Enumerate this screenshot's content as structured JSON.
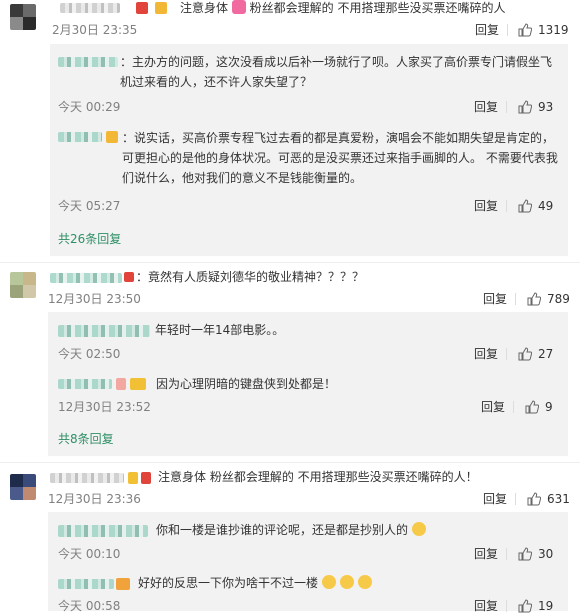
{
  "c0": {
    "text": "注意身体",
    "text2": "粉丝都会理解的  不用搭理那些没买票还嘴碎的人",
    "time": "2月30日 23:35",
    "reply": "回复",
    "likes": "1319"
  },
  "s1": {
    "text": "：主办方的问题，这次没看成以后补一场就行了呗。人家买了高价票专门请假坐飞机过来看的人，还不许人家失望了？",
    "time": "今天 00:29",
    "reply": "回复",
    "likes": "93"
  },
  "s2": {
    "text": "：说实话，买高价票专程飞过去看的都是真爱粉，演唱会不能如期失望是肯定的，可更担心的是他的身体状况。可恶的是没买票还过来指手画脚的人。 不需要代表我们说什么，他对我们的意义不是钱能衡量的。",
    "time": "今天 05:27",
    "reply": "回复",
    "likes": "49"
  },
  "more1": "共26条回复",
  "c1": {
    "text": "：竟然有人质疑刘德华的敬业精神？？？？",
    "time": "12月30日 23:50",
    "reply": "回复",
    "likes": "789"
  },
  "s3": {
    "text": "年轻时一年14部电影。。",
    "time": "今天 02:50",
    "reply": "回复",
    "likes": "27"
  },
  "s4": {
    "text": "因为心理阴暗的键盘侠到处都是！",
    "time": "12月30日 23:52",
    "reply": "回复",
    "likes": "9"
  },
  "more2": "共8条回复",
  "c2": {
    "text": "注意身体  粉丝都会理解的  不用搭理那些没买票还嘴碎的人！",
    "time": "12月30日 23:36",
    "reply": "回复",
    "likes": "631"
  },
  "s5": {
    "text": "你和一楼是谁抄谁的评论呢，还是都是抄别人的",
    "time": "今天 00:10",
    "reply": "回复",
    "likes": "30"
  },
  "s6": {
    "text": "好好的反思一下你为啥干不过一楼",
    "time": "今天 00:58",
    "reply": "回复",
    "likes": "19"
  },
  "icons": {
    "like": "thumbs-up-icon",
    "emoji": "emoji-icon"
  },
  "colors": {
    "link": "#2f8f66",
    "meta": "#808080",
    "subbg": "#f2f2f2"
  }
}
